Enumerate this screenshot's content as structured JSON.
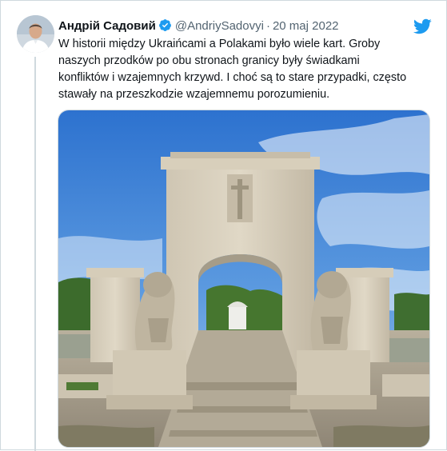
{
  "tweet": {
    "author_name": "Андрій Садовий",
    "handle": "@AndriySadovyi",
    "separator": "·",
    "date": "20 maj 2022",
    "text_lines": [
      "W historii między Ukraińcami a Polakami było wiele kart.  Groby",
      "naszych przodków po obu stronach granicy były świadkami",
      "konfliktów i wzajemnych krzywd.  I choć są to stare przypadki, często",
      "stawały na przeszkodzie wzajemnemu porozumieniu."
    ]
  },
  "icons": {
    "verified": "verified-badge-icon",
    "brand": "twitter-bird-icon"
  },
  "colors": {
    "accent": "#1d9bf0",
    "secondary_text": "#536471",
    "border": "#cfd9de"
  }
}
